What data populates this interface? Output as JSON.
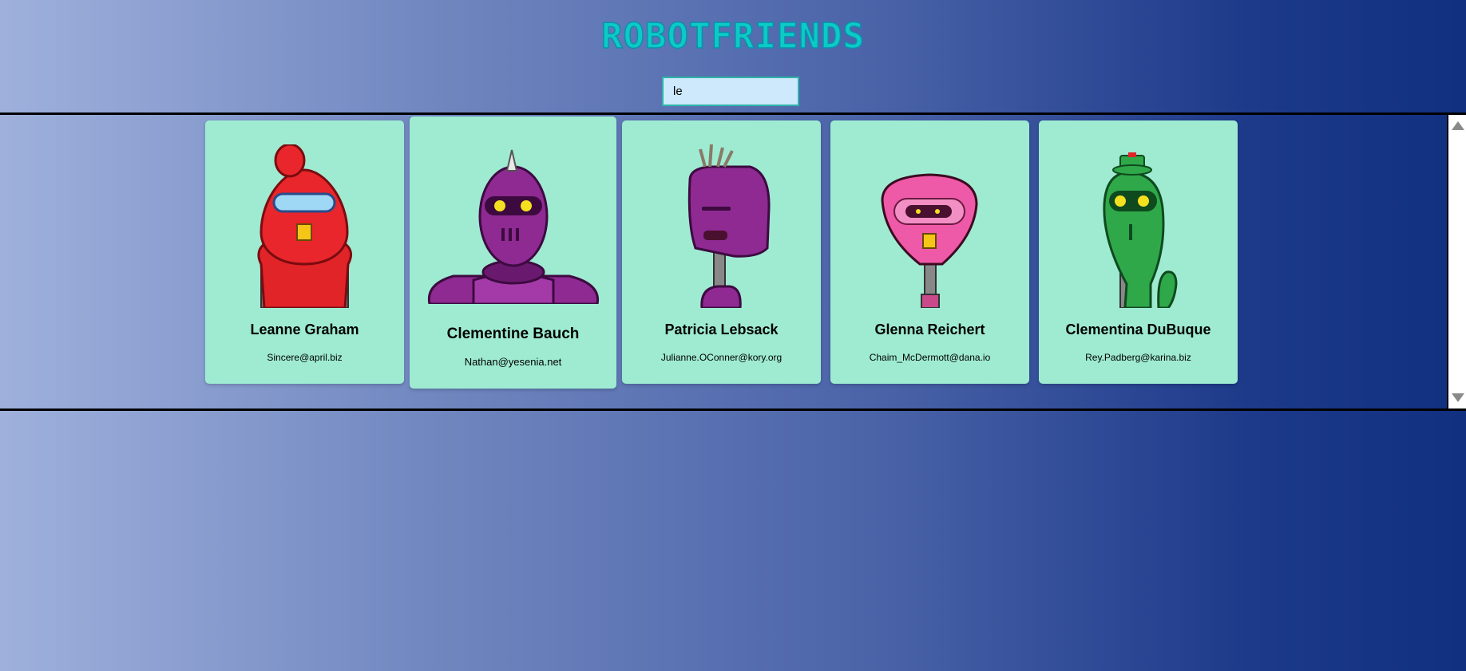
{
  "header": {
    "title": "ROBOTFRIENDS"
  },
  "search": {
    "value": "le",
    "placeholder": "search robots"
  },
  "robots": [
    {
      "name": "Leanne Graham",
      "email": "Sincere@april.biz",
      "color": "#e8262b"
    },
    {
      "name": "Clementine Bauch",
      "email": "Nathan@yesenia.net",
      "color": "#8e2a92"
    },
    {
      "name": "Patricia Lebsack",
      "email": "Julianne.OConner@kory.org",
      "color": "#8e2a92"
    },
    {
      "name": "Glenna Reichert",
      "email": "Chaim_McDermott@dana.io",
      "color": "#ef5aa8"
    },
    {
      "name": "Clementina DuBuque",
      "email": "Rey.Padberg@karina.biz",
      "color": "#2fa84a"
    }
  ],
  "colors": {
    "title": "#0ccac4",
    "card_bg": "#9eebd2",
    "search_bg": "#cde9fb"
  }
}
